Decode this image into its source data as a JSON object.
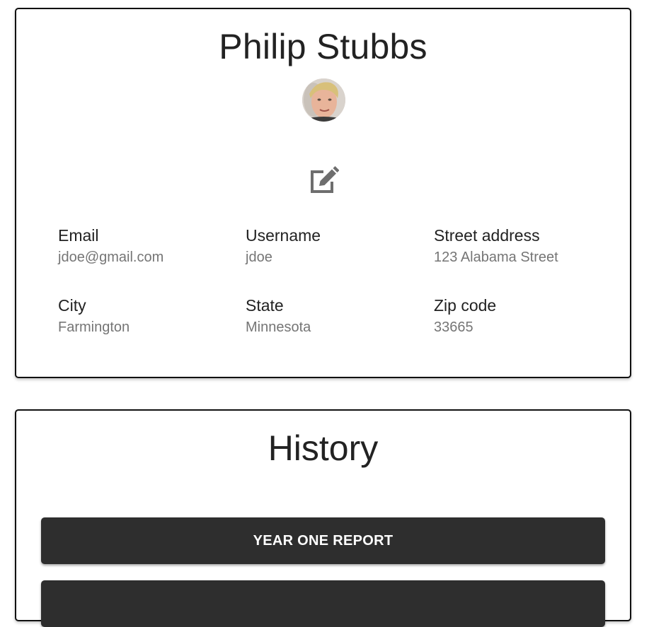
{
  "profile": {
    "name": "Philip Stubbs",
    "avatar_alt": "avatar",
    "edit_icon": "edit-icon",
    "fields": [
      {
        "label": "Email",
        "value": "jdoe@gmail.com"
      },
      {
        "label": "Username",
        "value": "jdoe"
      },
      {
        "label": "Street address",
        "value": "123 Alabama Street"
      },
      {
        "label": "City",
        "value": "Farmington"
      },
      {
        "label": "State",
        "value": "Minnesota"
      },
      {
        "label": "Zip code",
        "value": "33665"
      }
    ]
  },
  "history": {
    "title": "History",
    "buttons": [
      {
        "label": "YEAR ONE REPORT"
      },
      {
        "label": ""
      }
    ]
  },
  "colors": {
    "card_border": "#111111",
    "button_bg": "#2e2e2e",
    "button_text": "#ffffff",
    "label_text": "#222222",
    "value_text": "#757575",
    "icon": "#6e6e6e"
  }
}
